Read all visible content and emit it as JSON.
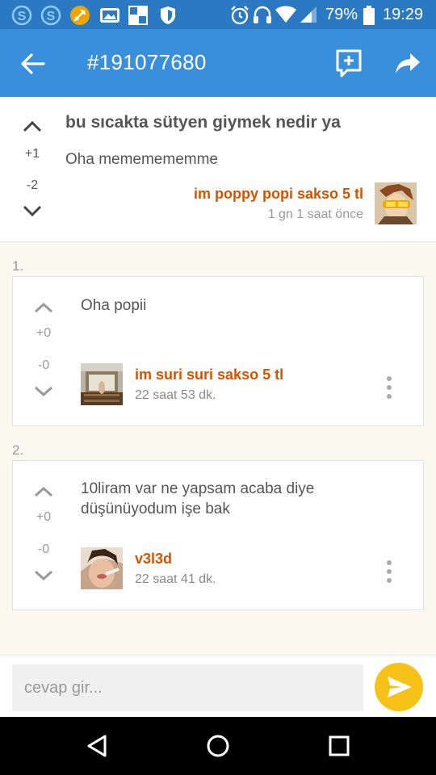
{
  "status_bar": {
    "battery": "79%",
    "time": "19:29",
    "colors": {
      "bar": "#2b79c2"
    }
  },
  "app_bar": {
    "title": "#191077680",
    "colors": {
      "bar": "#3a8fdc"
    }
  },
  "entry": {
    "title": "bu sıcakta sütyen giymek nedir ya",
    "body": "Oha mememememme",
    "up_votes": "+1",
    "down_votes": "-2",
    "author": "im poppy popi sakso 5 tl",
    "time": "1 gn 1 saat  önce"
  },
  "comments": [
    {
      "number": "1.",
      "text": "Oha popii",
      "up_votes": "+0",
      "down_votes": "-0",
      "author": "im suri suri sakso 5 tl",
      "time": "22 saat 53 dk."
    },
    {
      "number": "2.",
      "text": "10liram var ne yapsam acaba diye düşünüyodum işe bak",
      "up_votes": "+0",
      "down_votes": "-0",
      "author": "v3l3d",
      "time": "22 saat 41 dk."
    }
  ],
  "reply": {
    "placeholder": "cevap gir..."
  },
  "colors": {
    "author": "#d35400",
    "send_button": "#f6c218",
    "background": "#fbf8ef"
  },
  "icons": {
    "status": [
      "skype-icon",
      "skype-icon",
      "sword-icon",
      "gallery-icon",
      "app-icon",
      "shield-icon",
      "alarm-icon",
      "headset-icon",
      "wifi-icon",
      "signal-icon",
      "battery-icon"
    ],
    "app_bar": [
      "back-arrow-icon",
      "add-comment-icon",
      "share-icon"
    ],
    "nav": [
      "back-triangle-icon",
      "home-circle-icon",
      "recents-square-icon"
    ]
  }
}
